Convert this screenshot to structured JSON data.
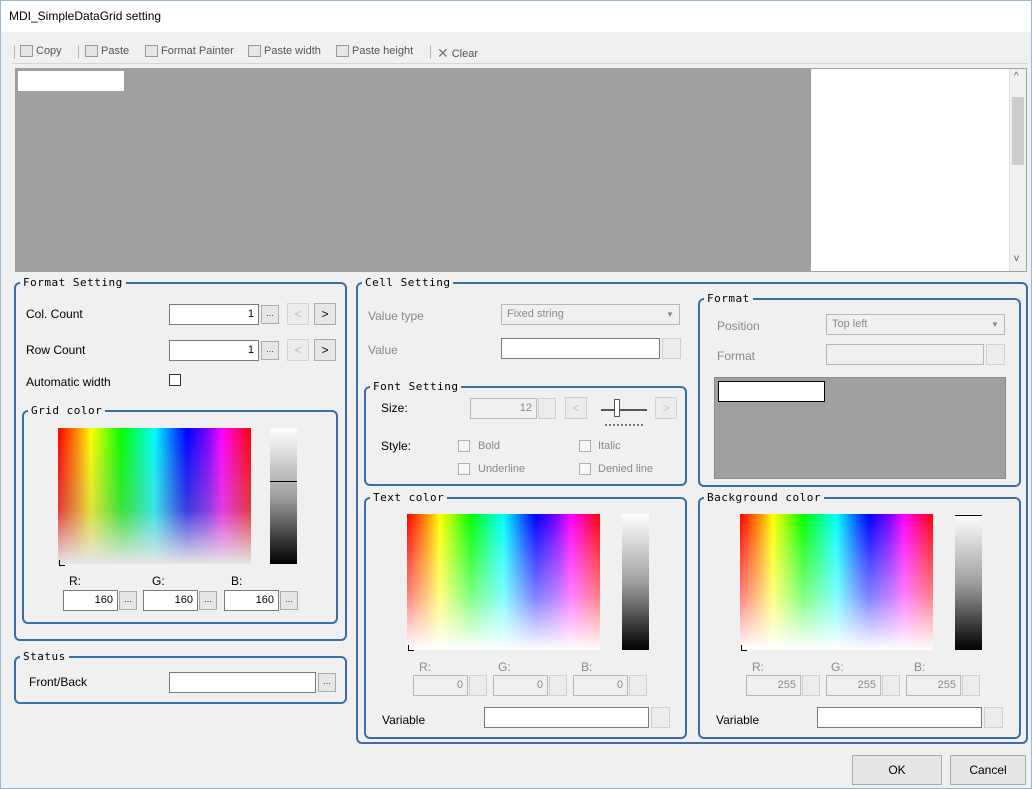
{
  "window": {
    "title": "MDI_SimpleDataGrid setting"
  },
  "toolbar": {
    "copy": "Copy",
    "paste": "Paste",
    "format_painter": "Format Painter",
    "paste_width": "Paste width",
    "paste_height": "Paste height",
    "clear": "Clear"
  },
  "grid_preview": {
    "scroll_up": "^",
    "scroll_down": "v"
  },
  "format_setting": {
    "legend": "Format Setting",
    "col_count_label": "Col. Count",
    "col_count_value": "1",
    "row_count_label": "Row Count",
    "row_count_value": "1",
    "automatic_width_label": "Automatic width",
    "browse": "...",
    "prev": "<",
    "next": ">"
  },
  "grid_color": {
    "legend": "Grid color",
    "r_label": "R:",
    "g_label": "G:",
    "b_label": "B:",
    "r": "160",
    "g": "160",
    "b": "160",
    "btn": "..."
  },
  "status": {
    "legend": "Status",
    "front_back_label": "Front/Back",
    "front_back_value": "",
    "browse": "..."
  },
  "cell_setting": {
    "legend": "Cell Setting",
    "value_type_label": "Value type",
    "value_type_value": "Fixed string",
    "value_label": "Value",
    "value_value": ""
  },
  "font_setting": {
    "legend": "Font Setting",
    "size_label": "Size:",
    "size_value": "12",
    "style_label": "Style:",
    "bold": "Bold",
    "italic": "Italic",
    "underline": "Underline",
    "denied_line": "Denied line",
    "prev": "<",
    "next": ">"
  },
  "format": {
    "legend": "Format",
    "position_label": "Position",
    "position_value": "Top left",
    "format_label": "Format",
    "format_value": ""
  },
  "text_color": {
    "legend": "Text color",
    "r_label": "R:",
    "g_label": "G:",
    "b_label": "B:",
    "r": "0",
    "g": "0",
    "b": "0",
    "variable_label": "Variable",
    "variable_value": ""
  },
  "background_color": {
    "legend": "Background color",
    "r_label": "R:",
    "g_label": "G:",
    "b_label": "B:",
    "r": "255",
    "g": "255",
    "b": "255",
    "variable_label": "Variable",
    "variable_value": ""
  },
  "buttons": {
    "ok": "OK",
    "cancel": "Cancel"
  },
  "colors": {
    "group_border": "#3a6ea5",
    "grid_gray": "#a0a0a0"
  }
}
